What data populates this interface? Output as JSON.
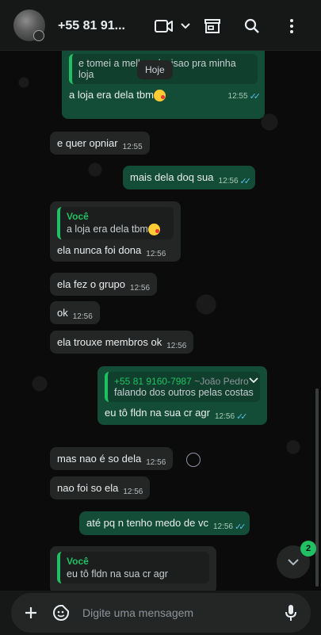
{
  "header": {
    "contact_name": "+55 81 91...",
    "icons": [
      "video-call-icon",
      "chevron-down-icon",
      "store-icon",
      "search-icon",
      "menu-icon"
    ]
  },
  "date_pill": "Hoje",
  "messages": [
    {
      "dir": "out",
      "text": "a loja era dela tbm",
      "time": "12:55",
      "quote_text": "e tomei a melhor decisao pra minha loja"
    },
    {
      "dir": "in",
      "text": "e quer opniar",
      "time": "12:55"
    },
    {
      "dir": "out",
      "text": "mais dela doq sua",
      "time": "12:56"
    },
    {
      "dir": "in",
      "text": "ela nunca foi dona",
      "time": "12:56",
      "quote_author": "Você",
      "quote_text": "a loja era dela tbm"
    },
    {
      "dir": "in",
      "text": "ela fez o grupo",
      "time": "12:56"
    },
    {
      "dir": "in",
      "text": "ok",
      "time": "12:56"
    },
    {
      "dir": "in",
      "text": "ela trouxe membros ok",
      "time": "12:56"
    },
    {
      "dir": "out",
      "text": "eu tô fldn na sua cr agr",
      "time": "12:56",
      "quote_author": "+55 81 9160-7987",
      "quote_author_alias": "~João Pedro",
      "quote_text": "falando dos outros pelas costas"
    },
    {
      "dir": "in",
      "text": "mas nao é so dela",
      "time": "12:56"
    },
    {
      "dir": "in",
      "text": "nao foi so ela",
      "time": "12:56"
    },
    {
      "dir": "out",
      "text": "até pq n tenho medo de vc",
      "time": "12:56"
    }
  ],
  "reply_preview": {
    "author": "Você",
    "text": "eu tô fldn na sua cr agr"
  },
  "unread_count": "2",
  "composer": {
    "placeholder": "Digite uma mensagem"
  },
  "colors": {
    "outgoing": "#144d37",
    "incoming": "#242626",
    "accent": "#21c063",
    "read_ticks": "#53bdeb"
  }
}
